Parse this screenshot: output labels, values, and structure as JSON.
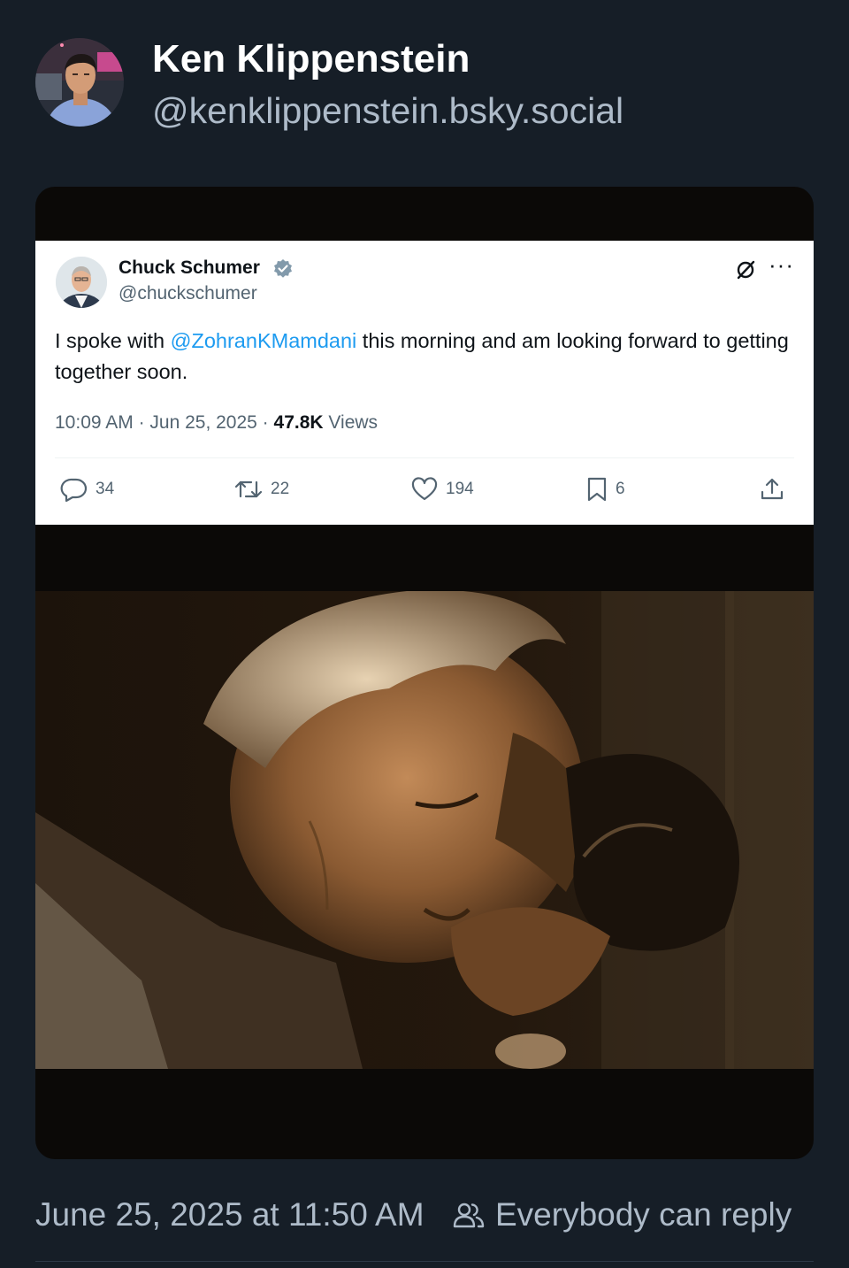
{
  "post": {
    "author_name": "Ken Klippenstein",
    "author_handle": "@kenklippenstein.bsky.social",
    "timestamp": "June 25, 2025 at 11:50 AM",
    "reply_setting": "Everybody can reply",
    "colors": {
      "background": "#161e27",
      "text": "#ffffff",
      "muted": "#aebbc9"
    }
  },
  "embedded_tweet": {
    "name": "Chuck Schumer",
    "handle": "@chuckschumer",
    "verified_icon": "verified-badge-icon",
    "text_before": "I spoke with ",
    "mention": "@ZohranKMamdani",
    "text_after": " this morning and am looking forward to getting together soon.",
    "time": "10:09 AM",
    "separator": " · ",
    "date": "Jun 25, 2025",
    "views_count": "47.8K",
    "views_label": " Views",
    "stats": {
      "replies": "34",
      "reposts": "22",
      "likes": "194",
      "bookmarks": "6"
    },
    "colors": {
      "link": "#1d9bf0",
      "verified": "#829aab"
    }
  },
  "icons": {
    "reply": "reply-icon",
    "repost": "repost-icon",
    "like": "heart-icon",
    "bookmark": "bookmark-icon",
    "share": "share-icon",
    "grok": "grok-icon",
    "more": "more-icon",
    "people": "people-icon"
  }
}
